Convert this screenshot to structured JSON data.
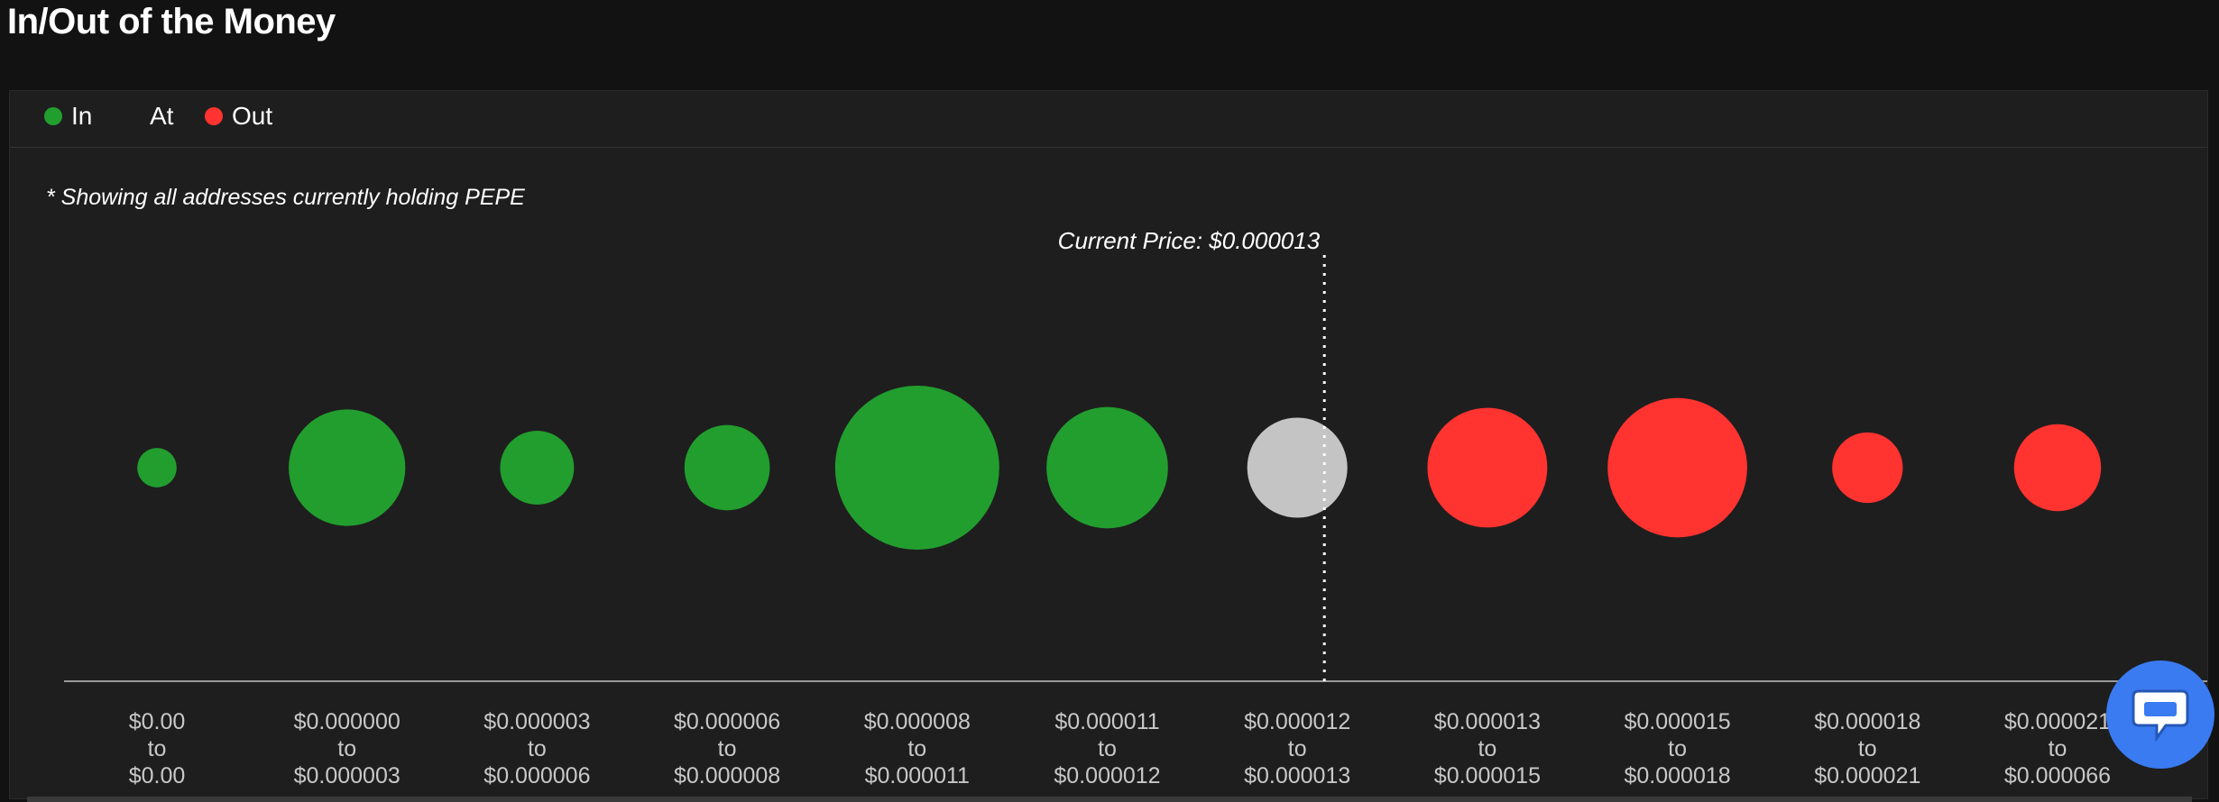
{
  "header": {
    "title": "In/Out of the Money"
  },
  "legend": {
    "items": [
      {
        "label": "In",
        "color": "#229e2f"
      },
      {
        "label": "At",
        "color": ""
      },
      {
        "label": "Out",
        "color": "#ff3330"
      }
    ]
  },
  "footnote": "* Showing all addresses currently holding PEPE",
  "chat": {
    "icon": "chat-bubble-icon"
  },
  "chart_data": {
    "type": "scatter",
    "title": "",
    "xlabel": "",
    "ylabel": "",
    "grid": false,
    "legend_position": "top-left",
    "current_price": {
      "label": "Current Price: $0.000013",
      "bucket_index": 6
    },
    "categories": [
      {
        "from": "$0.00",
        "to_word": "to",
        "to": "$0.00",
        "status": "In",
        "relative_size": 0.24
      },
      {
        "from": "$0.000000",
        "to_word": "to",
        "to": "$0.000003",
        "status": "In",
        "relative_size": 0.71
      },
      {
        "from": "$0.000003",
        "to_word": "to",
        "to": "$0.000006",
        "status": "In",
        "relative_size": 0.45
      },
      {
        "from": "$0.000006",
        "to_word": "to",
        "to": "$0.000008",
        "status": "In",
        "relative_size": 0.52
      },
      {
        "from": "$0.000008",
        "to_word": "to",
        "to": "$0.000011",
        "status": "In",
        "relative_size": 1.0
      },
      {
        "from": "$0.000011",
        "to_word": "to",
        "to": "$0.000012",
        "status": "In",
        "relative_size": 0.74
      },
      {
        "from": "$0.000012",
        "to_word": "to",
        "to": "$0.000013",
        "status": "At",
        "relative_size": 0.61
      },
      {
        "from": "$0.000013",
        "to_word": "to",
        "to": "$0.000015",
        "status": "Out",
        "relative_size": 0.73
      },
      {
        "from": "$0.000015",
        "to_word": "to",
        "to": "$0.000018",
        "status": "Out",
        "relative_size": 0.85
      },
      {
        "from": "$0.000018",
        "to_word": "to",
        "to": "$0.000021",
        "status": "Out",
        "relative_size": 0.43
      },
      {
        "from": "$0.000021",
        "to_word": "to",
        "to": "$0.000066",
        "status": "Out",
        "relative_size": 0.53
      }
    ],
    "status_colors": {
      "In": "#229e2f",
      "At": "#c4c4c4",
      "Out": "#ff3330"
    }
  }
}
